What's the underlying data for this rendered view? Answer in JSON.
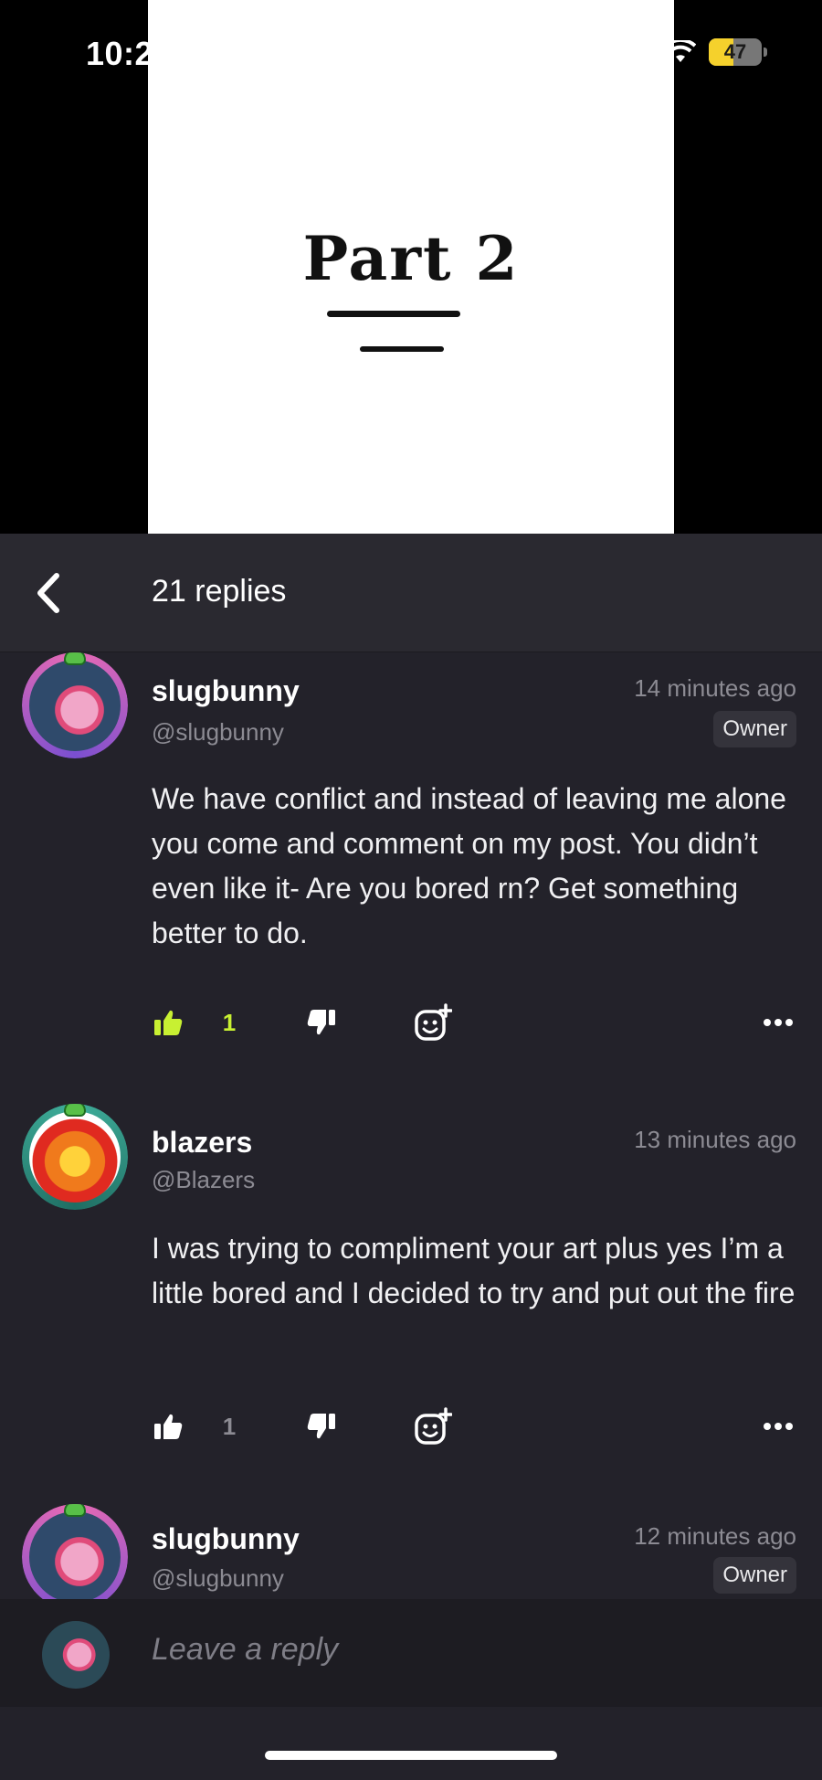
{
  "status_bar": {
    "time": "10:2",
    "battery": "47",
    "battery_level": 0.47
  },
  "media": {
    "title": "Part 2"
  },
  "header": {
    "title": "21 replies"
  },
  "comments": [
    {
      "username": "slugbunny",
      "handle": "@slugbunny",
      "time": "14 minutes ago",
      "badge": "Owner",
      "body": "We have conflict and instead of leaving me alone you come and comment on my post. You didn’t even like it- Are you bored rn? Get something better to do.",
      "likes": "1",
      "liked": true
    },
    {
      "username": "blazers",
      "handle": "@Blazers",
      "time": "13 minutes ago",
      "badge": "",
      "body": "I was trying to compliment your art plus yes I’m a little bored and I decided to try and put out the fire",
      "likes": "1",
      "liked": false
    },
    {
      "username": "slugbunny",
      "handle": "@slugbunny",
      "time": "12 minutes ago",
      "badge": "Owner"
    }
  ],
  "reply": {
    "placeholder": "Leave a reply"
  },
  "colors": {
    "liked": "#c8f032",
    "muted": "#8c8b93",
    "background": "#23222a"
  }
}
